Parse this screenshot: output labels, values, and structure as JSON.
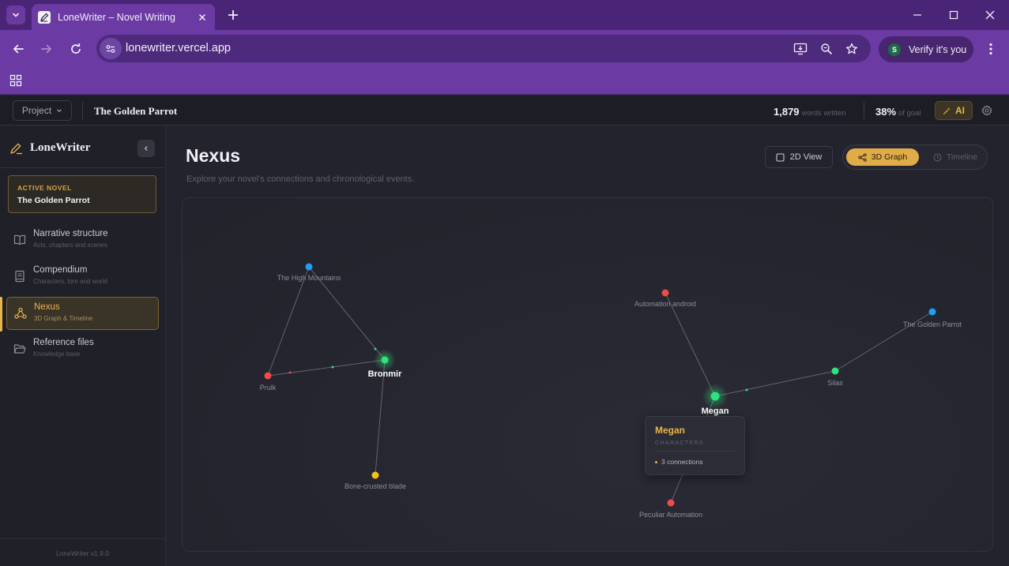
{
  "browser": {
    "tab_title": "LoneWriter – Novel Writing",
    "url": "lonewriter.vercel.app",
    "verify_label": "Verify it's you",
    "verify_avatar": "S"
  },
  "header": {
    "project_label": "Project",
    "novel_title": "The Golden Parrot",
    "words_count": "1,879",
    "words_label": "words written",
    "goal_percent": "38%",
    "goal_label": "of goal",
    "ai_label": "AI"
  },
  "sidebar": {
    "brand": "LoneWriter",
    "active_novel_label": "ACTIVE NOVEL",
    "active_novel_title": "The Golden Parrot",
    "items": [
      {
        "label": "Narrative structure",
        "sub": "Acts, chapters and scenes"
      },
      {
        "label": "Compendium",
        "sub": "Characters, lore and world"
      },
      {
        "label": "Nexus",
        "sub": "3D Graph & Timeline"
      },
      {
        "label": "Reference files",
        "sub": "Knowledge base"
      }
    ],
    "version": "LoneWriter v1.9.0"
  },
  "main": {
    "title": "Nexus",
    "subtitle": "Explore your novel's connections and chronological events.",
    "view2d_label": "2D View",
    "graph3d_label": "3D Graph",
    "timeline_label": "Timeline"
  },
  "graph": {
    "nodes": [
      {
        "label": "The High Mountains",
        "color": "#1e9ef5"
      },
      {
        "label": "Prulk",
        "color": "#f04a4a"
      },
      {
        "label": "Bronmir",
        "color": "#2ee27c"
      },
      {
        "label": "Bone-crusted blade",
        "color": "#f2c41a"
      },
      {
        "label": "Automation android",
        "color": "#f04a4a"
      },
      {
        "label": "The Golden Parrot",
        "color": "#1e9ef5"
      },
      {
        "label": "Silas",
        "color": "#2ee27c"
      },
      {
        "label": "Megan",
        "color": "#2ee27c"
      },
      {
        "label": "Peculiar Automation",
        "color": "#f04a4a"
      }
    ]
  },
  "tooltip": {
    "name": "Megan",
    "type": "CHARACTERS",
    "connections": "3 connections"
  }
}
